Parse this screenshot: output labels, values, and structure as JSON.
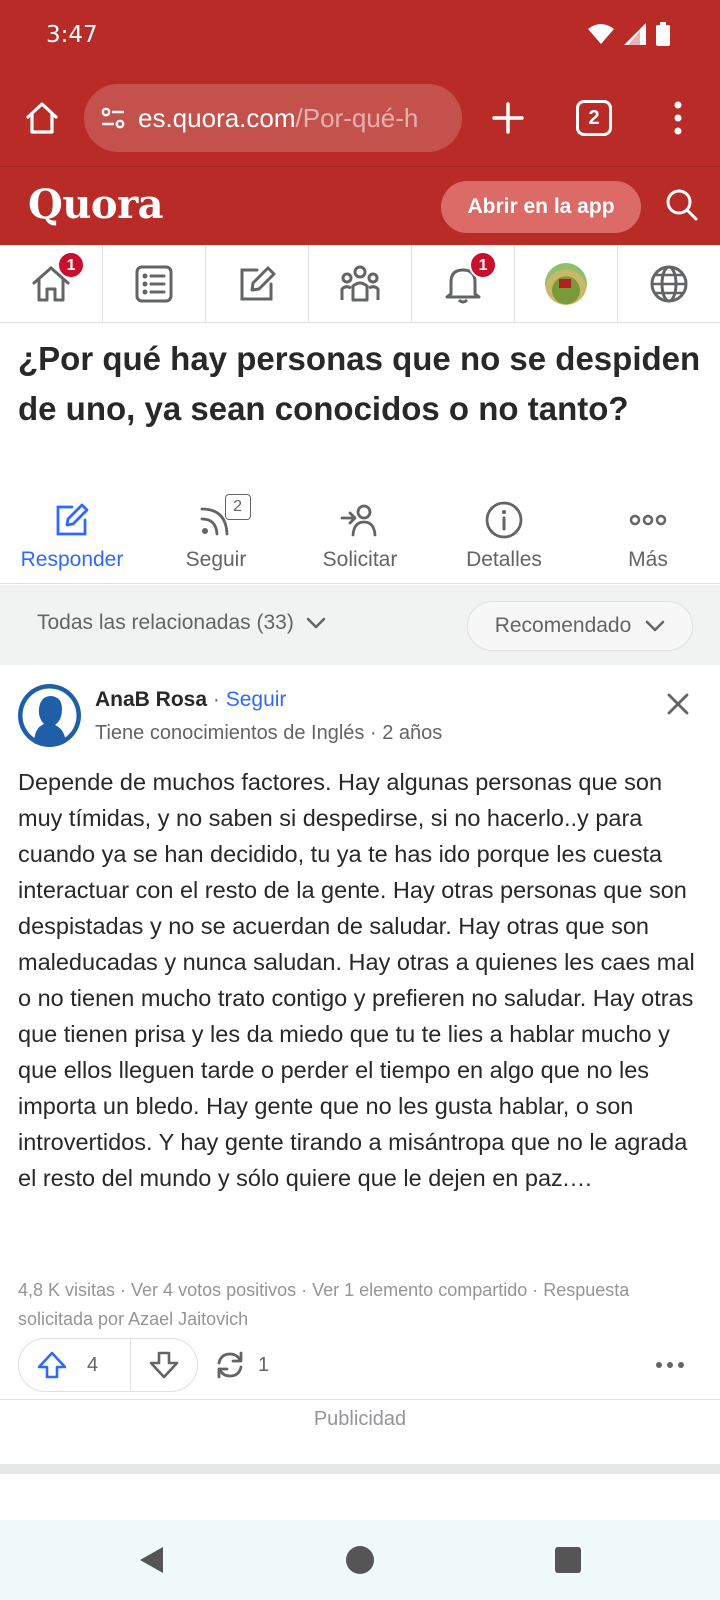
{
  "status_bar": {
    "time": "3:47"
  },
  "browser": {
    "url_host": "es.quora.com",
    "url_path": "/Por-qué-h",
    "tab_count": "2"
  },
  "header": {
    "logo": "Quora",
    "open_app_label": "Abrir en la app"
  },
  "nav": {
    "home_badge": "1",
    "notifications_badge": "1"
  },
  "question": {
    "title": "¿Por qué hay personas que no se despiden de uno, ya sean conocidos o no tanto?"
  },
  "actions": {
    "answer_label": "Responder",
    "follow_label": "Seguir",
    "follow_count": "2",
    "request_label": "Solicitar",
    "details_label": "Detalles",
    "more_label": "Más"
  },
  "filter": {
    "related_label": "Todas las relacionadas (33)",
    "sort_label": "Recomendado"
  },
  "answer": {
    "author_name": "AnaB Rosa",
    "separator": " · ",
    "follow_label": "Seguir",
    "credential": "Tiene conocimientos de Inglés · 2 años",
    "body": "Depende de muchos factores. Hay algunas personas que son muy tímidas, y no saben si despedirse, si no hacerlo..y para cuando ya se han decidido, tu ya te has ido porque les cuesta interactuar con el resto de la gente. Hay otras personas que son despistadas y no se acuerdan de saludar. Hay otras que son maleducadas y nunca saludan. Hay otras a quienes les caes mal o no tienen mucho trato contigo y prefieren no saludar. Hay otras que tienen prisa y les da miedo que tu te lies a hablar mucho y que ellos lleguen tarde o perder el tiempo en algo que no les importa un bledo. Hay gente que no les gusta hablar, o son introvertidos. Y hay gente tirando a misántropa que no le agrada el resto del mundo y sólo quiere que le dejen en paz.…",
    "meta": "4,8 K visitas · Ver 4 votos positivos · Ver 1 elemento compartido · Respuesta solicitada por Azael Jaitovich",
    "upvotes": "4",
    "shares": "1"
  },
  "ad_label": "Publicidad",
  "colors": {
    "brand_red": "#b92b27",
    "accent_blue": "#2e69ff",
    "badge_red": "#c8102e"
  }
}
